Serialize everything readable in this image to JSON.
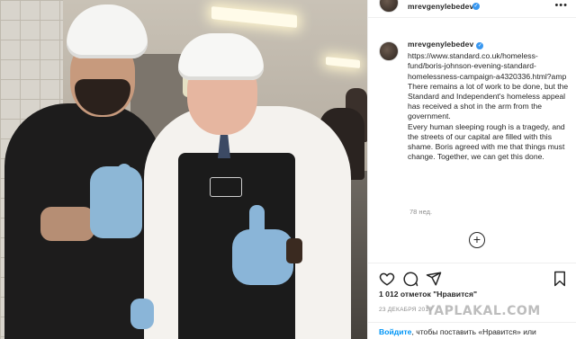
{
  "header": {
    "username": "mrevgenylebedev",
    "more_label": "•••"
  },
  "caption": {
    "username": "mrevgenylebedev",
    "text": "https://www.standard.co.uk/homeless-fund/boris-johnson-evening-standard-homelessness-campaign-a4320336.html?amp There remains a lot of work to be done, but the Standard and Independent's homeless appeal has received a shot in the arm from the government.\nEvery human sleeping rough is a tragedy, and the streets of our capital are filled with this shame. Boris agreed with me that things must change. Together, we can get this done.",
    "time_ago": "78 нед."
  },
  "comments": {
    "load_more_label": "+"
  },
  "actions": {
    "icons": [
      "heart-icon",
      "comment-icon",
      "share-icon",
      "bookmark-icon"
    ]
  },
  "likes": {
    "text": "1 012 отметок \"Нравится\""
  },
  "post_date": "23 ДЕКАБРЯ 2019",
  "footer": {
    "link": "Войдите",
    "text": ", чтобы поставить «Нравится» или"
  },
  "watermark": "YAPLAKAL.COM",
  "colors": {
    "link": "#0095f6",
    "verified": "#3897f0",
    "glove": "#8db7d6"
  }
}
